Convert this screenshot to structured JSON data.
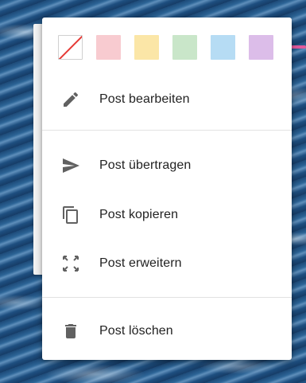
{
  "colors": {
    "menu_background": "#ffffff",
    "icon": "#616161",
    "text": "#222222",
    "pointer_arrow": "#e0599b"
  },
  "color_swatches": [
    {
      "name": "none",
      "color": "#ffffff",
      "icon": "slash-icon"
    },
    {
      "name": "red",
      "color": "#f8cbd0"
    },
    {
      "name": "yellow",
      "color": "#fbe6a7"
    },
    {
      "name": "green",
      "color": "#c9e6c9"
    },
    {
      "name": "blue",
      "color": "#b6dcf4"
    },
    {
      "name": "purple",
      "color": "#dcbde9"
    }
  ],
  "menu": {
    "edit": {
      "label": "Post bearbeiten",
      "icon": "pencil-icon"
    },
    "transfer": {
      "label": "Post übertragen",
      "icon": "send-icon"
    },
    "copy": {
      "label": "Post kopieren",
      "icon": "copy-icon"
    },
    "expand": {
      "label": "Post erweitern",
      "icon": "expand-icon"
    },
    "delete": {
      "label": "Post löschen",
      "icon": "trash-icon"
    }
  }
}
